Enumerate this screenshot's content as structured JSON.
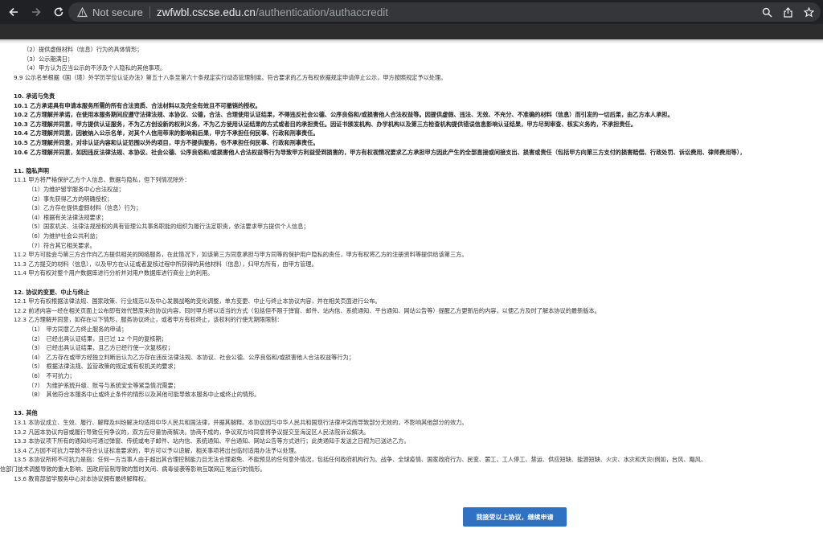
{
  "browser": {
    "back_icon": "arrow-left",
    "forward_icon": "arrow-right",
    "reload_icon": "reload",
    "security_label": "Not secure",
    "url_host": "zwfwbl.cscse.edu.cn",
    "url_path": "/authentication/authaccredit"
  },
  "agreement": {
    "lines": [
      {
        "text": "（2）提供虚假材料（信息）行为的具体情形；",
        "style": "",
        "x": 29
      },
      {
        "text": "（3）公示期满日；",
        "style": "",
        "x": 29
      },
      {
        "text": "（4）甲方认为应当公示的不涉及个人隐私的其他事项。",
        "style": "",
        "x": 29
      },
      {
        "text": "9.9  公示名单根据《国（境）外学历学位认证办法》第五十八条至第六十条规定实行动态管理制度。符合要求的乙方有权依据规定申请停止公示，甲方按照规定予以处理。",
        "style": "",
        "x": 17
      },
      {
        "text": "",
        "style": "",
        "x": 17
      },
      {
        "text": "10.  承诺与免责",
        "style": "head",
        "x": 17
      },
      {
        "text": "10.1  乙方承诺具有申请本服务所需的所有合法资质、合法材料以及完全有效且不可撤销的授权。",
        "style": "b",
        "x": 17
      },
      {
        "text": "10.2  乙方理解并承诺，在使用本服务期间应遵守法律法规、本协议、公德，合法、合理使用认证结果，不得违反社会公德、公序良俗和/或损害他人合法权益等。因提供虚假、违法、无效、不充分、不准确的材料（信息）而引发的一切后果，由乙方本人承担。",
        "style": "b",
        "x": 17
      },
      {
        "text": "10.3  乙方理解并同意，甲方提供认证服务，不为乙方创设新的权利义务，不为乙方使用认证结果的方式或者目的承担责任。因证书颁发机构、办学机构以及第三方检查机构提供错误信息影响认证结果，甲方尽到审查、核实义务的，不承担责任。",
        "style": "b",
        "x": 17
      },
      {
        "text": "10.4  乙方理解并同意，因被纳入公示名单，对其个人信用带来的影响和后果，甲方不承担任何民事、行政和刑事责任。",
        "style": "b",
        "x": 17
      },
      {
        "text": "10.5  乙方理解并同意，对非认证内容和认证范围以外的项目，甲方不提供服务，也不承担任何民事、行政和刑事责任。",
        "style": "b",
        "x": 17
      },
      {
        "text": "10.6  乙方理解并同意，如因违反法律法规、本协议、社会公德、公序良俗和/或损害他人合法权益等行为导致甲方利益受到损害的，甲方有权视情况要求乙方承担甲方因此产生的全部直接或间接支出、损害或责任（包括甲方向第三方支付的损害赔偿、行政处罚、诉讼费用、律师费用等），",
        "style": "b",
        "x": 17
      },
      {
        "text": "",
        "style": "",
        "x": 17
      },
      {
        "text": "11.  隐私声明",
        "style": "head",
        "x": 17
      },
      {
        "text": "11.1  甲方将严格保护乙方个人信息、数据与隐私，但下列情况除外：",
        "style": "",
        "x": 17
      },
      {
        "text": "（1）为维护留学服务中心合法权益；",
        "style": "",
        "x": 35
      },
      {
        "text": "（2）事先获得乙方的明确授权；",
        "style": "",
        "x": 35
      },
      {
        "text": "（3）乙方存在提供虚假材料（信息）行为；",
        "style": "",
        "x": 35
      },
      {
        "text": "（4）根据有关法律法规要求；",
        "style": "",
        "x": 35
      },
      {
        "text": "（5）国家机关、法律法规授权的具有管理公共事务职能的组织为履行法定职责，依法要求甲方提供个人信息；",
        "style": "",
        "x": 35
      },
      {
        "text": "（6）为维护社会公共利益；",
        "style": "",
        "x": 35
      },
      {
        "text": "（7）符合其它相关要求。",
        "style": "",
        "x": 35
      },
      {
        "text": "11.2  甲方可能会与第三方合作向乙方提供相关的网络服务，在此情况下，如该第三方同意承担与甲方同等的保护用户隐私的责任，甲方有权将乙方的注册资料等提供给该第三方。",
        "style": "",
        "x": 17
      },
      {
        "text": "11.3  乙方提交的材料（信息），以及甲方在认证或者复核过程中所获得的其他材料（信息），归甲方所有，由甲方管理。",
        "style": "",
        "x": 17
      },
      {
        "text": "11.4  甲方有权对整个用户数据库进行分析并对用户数据库进行商业上的利用。",
        "style": "",
        "x": 17
      },
      {
        "text": "",
        "style": "",
        "x": 17
      },
      {
        "text": "12.  协议的变更、中止与终止",
        "style": "head",
        "x": 17
      },
      {
        "text": "12.1  甲方有权根据法律法规、国家政策、行业规范以及中心发展战略的变化调整，单方变更、中止与终止本协议内容，并在相关页面进行公布。",
        "style": "",
        "x": 17
      },
      {
        "text": "12.2  前述内容一经在相关页面上公布即有效代替原来的协议内容，同时甲方将以适当的方式（包括但不限于弹窗、邮件、站内信、系统通知、平台通知、网站公告等）提醒乙方更新后的内容，以便乙方及时了解本协议的最新版本。",
        "style": "",
        "x": 17
      },
      {
        "text": "12.3  乙方理解并同意，如存在以下情形，服务协议终止，或者甲方有权终止，该权利的行使无期限限制：",
        "style": "",
        "x": 17
      },
      {
        "text": "（1）　甲方同意乙方终止服务的申请；",
        "style": "",
        "x": 35
      },
      {
        "text": "（2）　已经出具认证结果，且已过 12 个月的复核期；",
        "style": "",
        "x": 35
      },
      {
        "text": "（3）　已经出具认证结果，且乙方已经行使一次复核权；",
        "style": "",
        "x": 35
      },
      {
        "text": "（4）　乙方存在或甲方经独立判断后认为乙方存在违反法律法规、本协议、社会公德、公序良俗和/或损害他人合法权益等行为；",
        "style": "",
        "x": 35
      },
      {
        "text": "（5）　根据法律法规、监管政策的规定或有权机关的要求；",
        "style": "",
        "x": 35
      },
      {
        "text": "（6）　不可抗力；",
        "style": "",
        "x": 35
      },
      {
        "text": "（7）　为维护系统升级、账号与系统安全等紧急情况需要；",
        "style": "",
        "x": 35
      },
      {
        "text": "（8）　其他符合本服务中止或终止条件的情形以及其他可能导致本服务中止或终止的情形。",
        "style": "",
        "x": 35
      },
      {
        "text": "",
        "style": "",
        "x": 17
      },
      {
        "text": "13.  其他",
        "style": "head",
        "x": 17
      },
      {
        "text": "13.1  本协议成立、生效、履行、解释及纠纷解决均适用中华人民共和国法律，并据其解释。本协议因与中华人民共和国现行法律冲突而导致部分无效的，不影响其他部分的效力。",
        "style": "",
        "x": 17
      },
      {
        "text": "13.2  凡因本协议内容或履行导致任何争议的，双方应尽量协商解决。协商不成的，争议双方均同意将争议提交至海淀区人民法院诉讼解决。",
        "style": "",
        "x": 17
      },
      {
        "text": "13.3  本协议项下所有的通知均可通过弹窗、传统或电子邮件、站内信、系统通知、平台通知、网站公告等方式进行；此类通知于发送之日视为已送达乙方。",
        "style": "",
        "x": 17
      },
      {
        "text": "13.4  乙方因不可抗力导致不符合认证标准要求的，甲方可以予以谅解，相关事项将出台临时适用办法予以处理。",
        "style": "",
        "x": 17
      },
      {
        "text": "13.5  本协议所称不可抗力是指：任何一方当事人由于超出其合理控制能力且无法合理避免、不能预见的任何意外情况，包括任何政府机构行为、战争、全球疫情、国家政府行为、民变、罢工、工人停工、禁运、供应短缺、能源短缺、火灾、水灾和天灾(例如，台风、飓风、",
        "style": "",
        "x": 17
      },
      {
        "text": "信部门技术调整导致的重大影响、因政府管制导致的暂时关闭、病毒侵袭等影响互联网正常运行的情形。",
        "style": "",
        "x": 0
      },
      {
        "text": "13.6  教育部留学服务中心对本协议拥有最终解释权。",
        "style": "",
        "x": 17
      }
    ],
    "submit_label": "我接受以上协议，继续申请"
  }
}
